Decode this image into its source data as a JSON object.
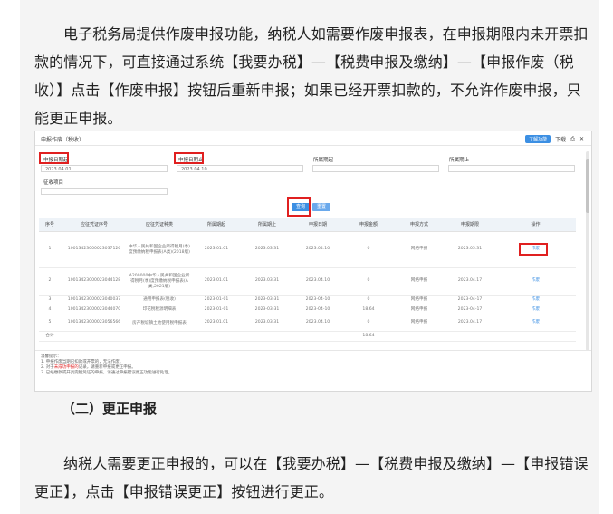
{
  "paragraph1": "电子税务局提供作废申报功能，纳税人如需要作废申报表，在申报期限内未开票扣款的情况下，可直接通过系统【我要办税】—【税费申报及缴纳】—【申报作废（税收）】点击【作废申报】按钮后重新申报；如果已经开票扣款的，不允许作废申报，只能更正申报。",
  "section_title": "（二）更正申报",
  "paragraph2": "纳税人需要更正申报的，可以在【我要办税】—【税费申报及缴纳】—【申报错误更正】，点击【申报错误更正】按钮进行更正。",
  "shot": {
    "title": "申报作废（税收）",
    "help_label": "了解功能",
    "download_label": "下载",
    "form": {
      "field1_label": "申报日期起",
      "field1_value": "2023.04.01",
      "field2_label": "申报日期止",
      "field2_value": "2023.04.10",
      "field3_label": "所属期起",
      "field4_label": "所属期止",
      "field5_label": "征收项目"
    },
    "query_label": "查询",
    "reset_label": "重置",
    "columns": [
      "序号",
      "应征凭证序号",
      "应征凭证种类",
      "所属期起",
      "所属期止",
      "申报日期",
      "申报金额",
      "申报方式",
      "申报期限",
      "操作"
    ],
    "rows": [
      [
        "1",
        "10013423000023037126",
        "中华人民共和国企业所得税月(季)度预缴纳税申报表(A类)(2018版)",
        "2023.01.01",
        "2023.03.31",
        "2023.04.10",
        "0",
        "网络申报",
        "2023.05.31",
        "作废"
      ],
      [
        "2",
        "10013423000023044128",
        "A200000中华人民共和国企业所得税月(季)度预缴纳税申报表(A类,2021版)",
        "2023.01.01",
        "2023.03.31",
        "2023.04.10",
        "0",
        "网络申报",
        "2023.04.17",
        "作废"
      ],
      [
        "3",
        "10013423000023040037",
        "通用申报表(税收)",
        "2023-01-01",
        "2023-03-31",
        "2023-04-10",
        "0",
        "网络申报",
        "2023-04-17",
        "作废"
      ],
      [
        "4",
        "10013423000023044070",
        "印花税税源明细表",
        "2023-01-01",
        "2023-03-31",
        "2023-04-10",
        "18.64",
        "网络申报",
        "2023-04-17",
        "作废"
      ],
      [
        "5",
        "10013423000023056566",
        "房产税城镇土地使用税申报表",
        "2023.01.01",
        "2023.03.31",
        "2023.04.10",
        "0",
        "网络申报",
        "2023.04.17",
        "作废"
      ]
    ],
    "total_label": "合计",
    "total_value": "18.64",
    "notes_title": "温馨提示：",
    "note1": "1. 申报作废当期已扣款或开票的，无法作废。",
    "note2_prefix": "2. 对于",
    "note2_red": "未成功申报的",
    "note2_suffix": "记录，请重新申报或更正申报。",
    "note3": "3. 已经缴款或开具完税凭证的申报，请通过申报错误更正功能进行处理。"
  }
}
